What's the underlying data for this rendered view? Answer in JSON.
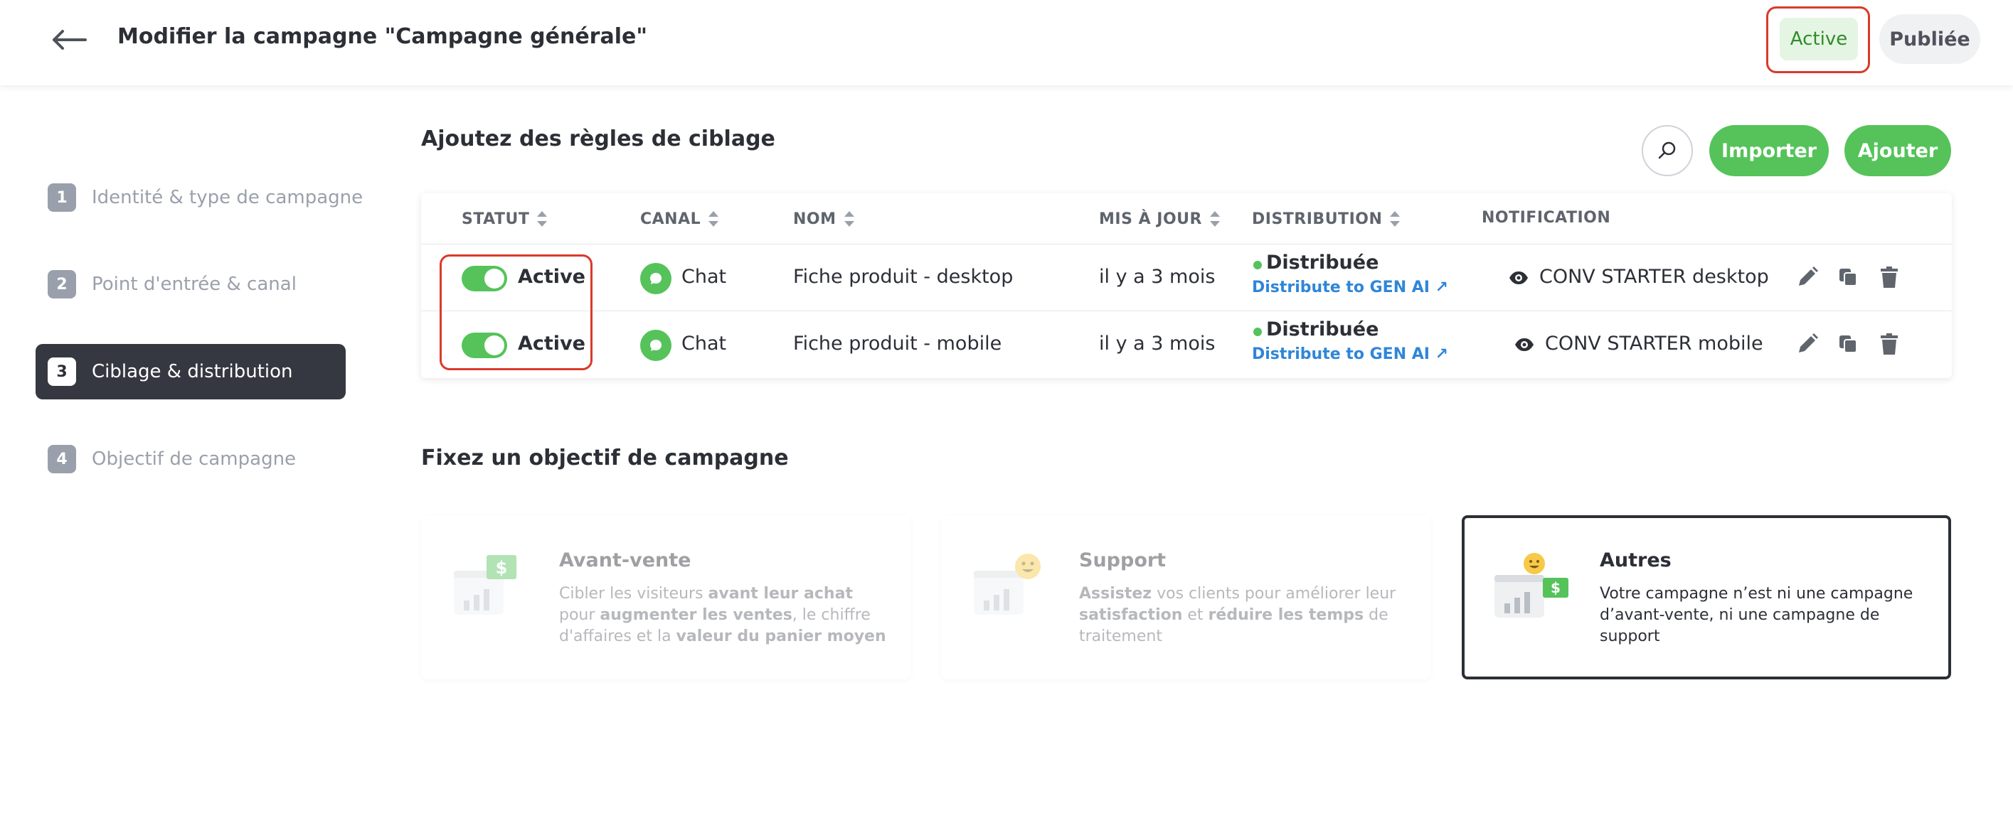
{
  "header": {
    "title": "Modifier la campagne \"Campagne générale\"",
    "status_active": "Active",
    "status_published": "Publiée"
  },
  "sidebar": {
    "steps": [
      {
        "num": "1",
        "label": "Identité & type de campagne"
      },
      {
        "num": "2",
        "label": "Point d'entrée & canal"
      },
      {
        "num": "3",
        "label": "Ciblage & distribution"
      },
      {
        "num": "4",
        "label": "Objectif de campagne"
      }
    ],
    "active_step": 3
  },
  "targeting": {
    "title": "Ajoutez des règles de ciblage",
    "import_label": "Importer",
    "add_label": "Ajouter",
    "columns": [
      "STATUT",
      "CANAL",
      "NOM",
      "MIS À JOUR",
      "DISTRIBUTION",
      "NOTIFICATION"
    ],
    "rows": [
      {
        "status": "Active",
        "channel": "Chat",
        "name": "Fiche produit - desktop",
        "updated": "il y a 3 mois",
        "distribution": "Distribuée",
        "distribution_link": "Distribute to GEN AI ↗",
        "notification": "CONV STARTER desktop"
      },
      {
        "status": "Active",
        "channel": "Chat",
        "name": "Fiche produit - mobile",
        "updated": "il y a 3 mois",
        "distribution": "Distribuée",
        "distribution_link": "Distribute to GEN AI ↗",
        "notification": "CONV STARTER mobile"
      }
    ]
  },
  "objective": {
    "title": "Fixez un objectif de campagne",
    "cards": [
      {
        "title": "Avant-vente",
        "desc_parts": [
          "Cibler les visiteurs ",
          "avant leur achat",
          " pour ",
          "augmenter les ventes",
          ", le chiffre d'affaires et la ",
          "valeur du panier moyen"
        ]
      },
      {
        "title": "Support",
        "desc_parts": [
          "Assistez",
          " vos clients pour améliorer leur ",
          "satisfaction",
          " et ",
          "réduire les temps",
          " de traitement"
        ]
      },
      {
        "title": "Autres",
        "desc": "Votre campagne n’est ni une campagne d’avant-vente, ni une campagne de support"
      }
    ],
    "selected": "Autres"
  },
  "colors": {
    "accent_green": "#55c35a",
    "highlight_red": "#d93a2b",
    "link_blue": "#2f86d8",
    "dark": "#353840"
  }
}
